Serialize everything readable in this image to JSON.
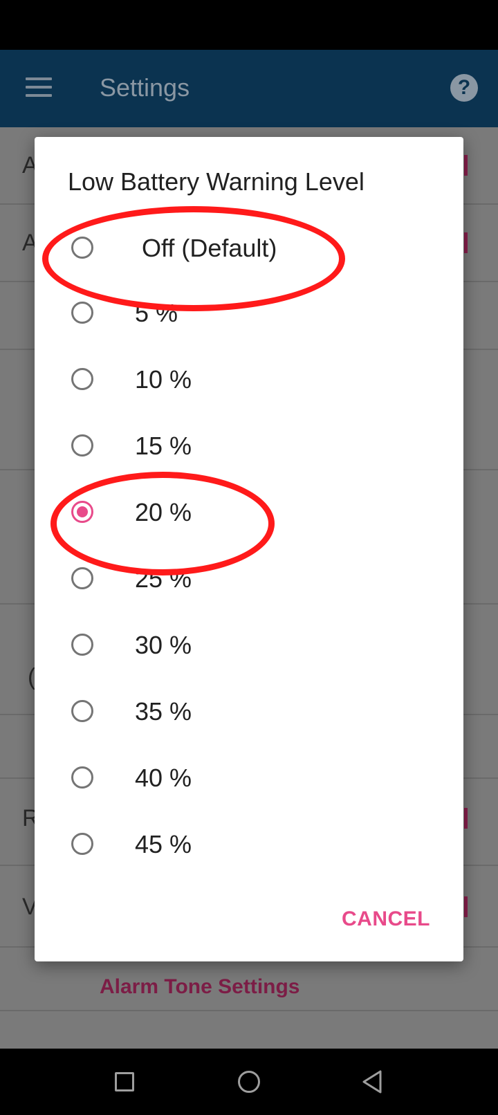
{
  "app_bar": {
    "title": "Settings",
    "menu_icon": "hamburger-menu-icon",
    "help_icon": "help-icon",
    "help_glyph": "?"
  },
  "background": {
    "row_fragments": [
      "A",
      "A",
      "",
      "",
      "",
      "(",
      "",
      "R",
      "V"
    ],
    "alarm_link": "Alarm Tone Settings"
  },
  "dialog": {
    "title": "Low Battery Warning Level",
    "options": [
      {
        "label": "Off (Default)",
        "selected": false
      },
      {
        "label": "5 %",
        "selected": false
      },
      {
        "label": "10 %",
        "selected": false
      },
      {
        "label": "15 %",
        "selected": false
      },
      {
        "label": "20 %",
        "selected": true
      },
      {
        "label": "25 %",
        "selected": false
      },
      {
        "label": "30 %",
        "selected": false
      },
      {
        "label": "35 %",
        "selected": false
      },
      {
        "label": "40 %",
        "selected": false
      },
      {
        "label": "45 %",
        "selected": false
      }
    ],
    "cancel_label": "CANCEL"
  },
  "colors": {
    "app_bar": "#0b3350",
    "accent": "#e84a8a",
    "annotation": "#ff1a1a"
  },
  "nav_bar": {
    "icons": [
      "recents-icon",
      "home-icon",
      "back-icon"
    ]
  }
}
